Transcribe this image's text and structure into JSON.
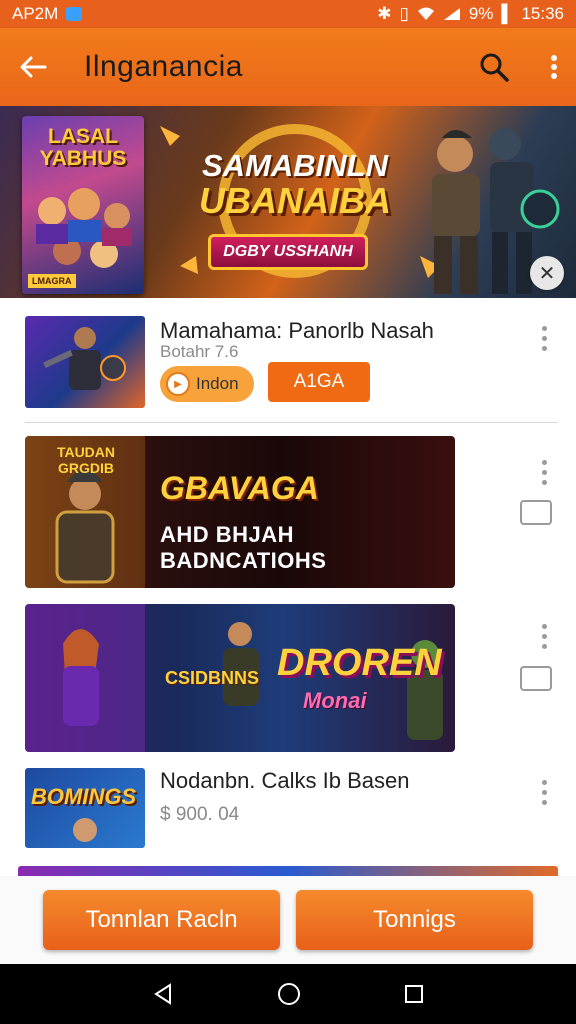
{
  "status_bar": {
    "carrier": "AP2M",
    "battery": "9%",
    "time": "15:36"
  },
  "app_bar": {
    "title": "Ilnganancia",
    "back_icon": "arrow-left-icon",
    "search_icon": "search-icon",
    "menu_icon": "more-vert-icon"
  },
  "hero": {
    "poster_title": "LASAL YABHUS",
    "poster_tag": "LMAGRA",
    "line1": "SAMABINLN",
    "line2": "UBANAIBA",
    "ribbon": "DGBY USSHANH"
  },
  "items": [
    {
      "title": "Mamahama: Panorlb Nasah",
      "subtitle": "Botahr 7.6",
      "chip_label": "Indon",
      "button_label": "A1GA"
    },
    {
      "banner_title": "GBAVAGA",
      "banner_subtitle": "AHD BHJAH BADNCATIOHS",
      "banner_corner": "TAUDAN GRGDIB"
    },
    {
      "banner_title": "DROREN",
      "banner_subtitle": "Monai",
      "banner_side": "CSIDBNNS"
    },
    {
      "title": "Nodanbn. Calks Ib Basen",
      "subtitle": "$ 900. 04",
      "thumb_title": "BOMINGS"
    }
  ],
  "bottom_buttons": {
    "left": "Tonnlan Racln",
    "right": "Tonnigs"
  },
  "colors": {
    "accent": "#e8611c",
    "button": "#f06a14"
  }
}
